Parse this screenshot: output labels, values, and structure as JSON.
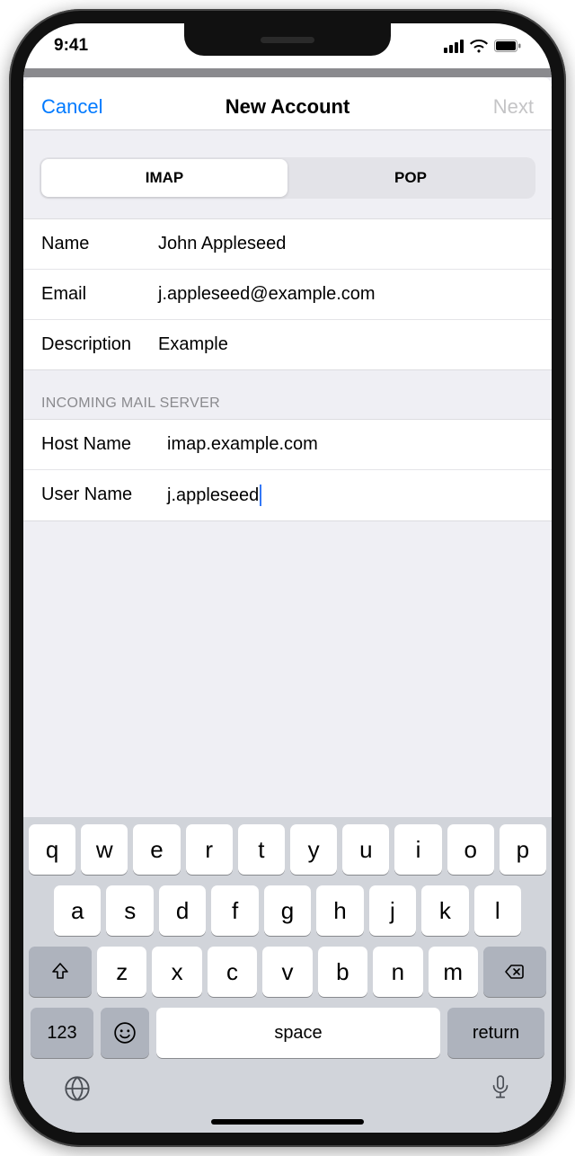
{
  "status": {
    "time": "9:41"
  },
  "nav": {
    "cancel": "Cancel",
    "title": "New Account",
    "next": "Next"
  },
  "segmented": {
    "imap": "IMAP",
    "pop": "POP"
  },
  "account": {
    "name_label": "Name",
    "name_value": "John Appleseed",
    "email_label": "Email",
    "email_value": "j.appleseed@example.com",
    "description_label": "Description",
    "description_value": "Example"
  },
  "incoming": {
    "header": "INCOMING MAIL SERVER",
    "host_label": "Host Name",
    "host_value": "imap.example.com",
    "user_label": "User Name",
    "user_value": "j.appleseed"
  },
  "keyboard": {
    "row1": [
      "q",
      "w",
      "e",
      "r",
      "t",
      "y",
      "u",
      "i",
      "o",
      "p"
    ],
    "row2": [
      "a",
      "s",
      "d",
      "f",
      "g",
      "h",
      "j",
      "k",
      "l"
    ],
    "row3": [
      "z",
      "x",
      "c",
      "v",
      "b",
      "n",
      "m"
    ],
    "numbers": "123",
    "space": "space",
    "return": "return"
  }
}
